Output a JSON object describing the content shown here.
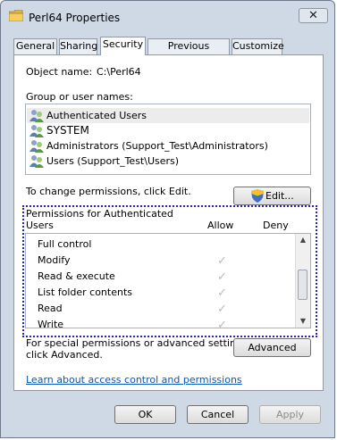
{
  "window": {
    "title": "Perl64 Properties",
    "close_glyph": "✕",
    "colors": {
      "chrome": "#cfd9e6",
      "accent": "#2222d8",
      "link": "#0a56b6"
    }
  },
  "tabs": [
    {
      "label": "General"
    },
    {
      "label": "Sharing"
    },
    {
      "label": "Security",
      "selected": true
    },
    {
      "label": "Previous Versions"
    },
    {
      "label": "Customize"
    }
  ],
  "security": {
    "object_name_label": "Object name:",
    "object_name_value": "C:\\Perl64",
    "groups_label": "Group or user names:",
    "groups": [
      {
        "name": "Authenticated Users",
        "icon": "user-group-icon"
      },
      {
        "name": "SYSTEM",
        "icon": "user-group-icon"
      },
      {
        "name": "Administrators (Support_Test\\Administrators)",
        "icon": "user-group-icon"
      },
      {
        "name": "Users (Support_Test\\Users)",
        "icon": "user-group-icon"
      }
    ],
    "change_text": "To change permissions, click Edit.",
    "edit_button": "Edit...",
    "permissions_title_line1": "Permissions for Authenticated",
    "permissions_title_line2": "Users",
    "allow_header": "Allow",
    "deny_header": "Deny",
    "permissions": [
      {
        "name": "Full control",
        "allow": false,
        "deny": false
      },
      {
        "name": "Modify",
        "allow": true,
        "deny": false
      },
      {
        "name": "Read & execute",
        "allow": true,
        "deny": false
      },
      {
        "name": "List folder contents",
        "allow": true,
        "deny": false
      },
      {
        "name": "Read",
        "allow": true,
        "deny": false
      },
      {
        "name": "Write",
        "allow": true,
        "deny": false
      }
    ],
    "check_glyph": "✓",
    "special_text_line1": "For special permissions or advanced settings,",
    "special_text_line2": "click Advanced.",
    "advanced_button": "Advanced",
    "learn_link": "Learn about access control and permissions"
  },
  "buttons": {
    "ok": "OK",
    "cancel": "Cancel",
    "apply": "Apply"
  }
}
